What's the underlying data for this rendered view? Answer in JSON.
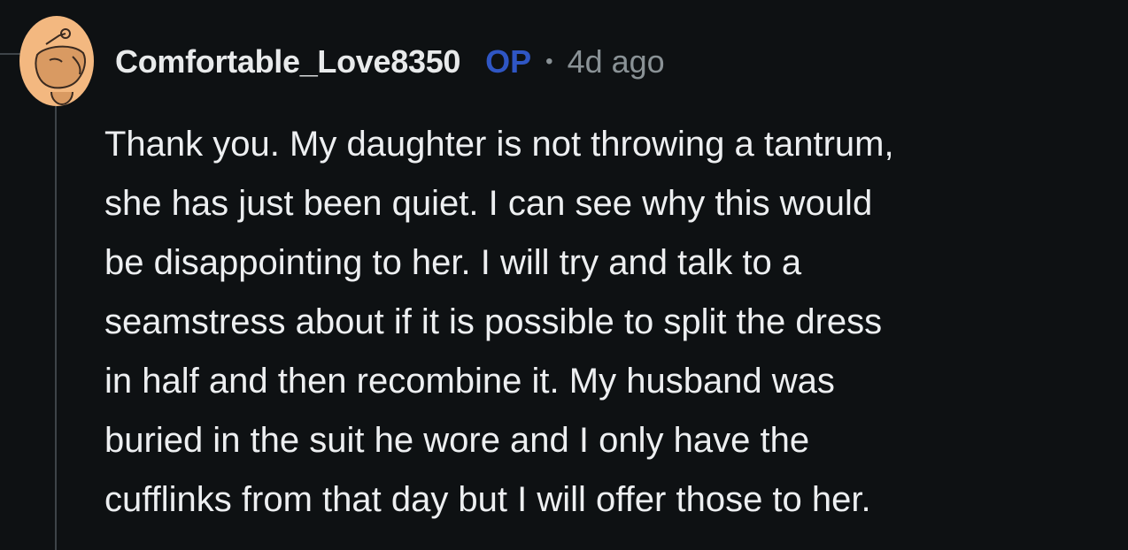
{
  "comment": {
    "author": "Comfortable_Love8350",
    "op_badge": "OP",
    "separator": "•",
    "timestamp": "4d ago",
    "avatar": "snoo-avatar-icon",
    "body_lines": [
      "Thank you. My daughter is not throwing a tantrum,",
      "she has just been quiet. I can see why this would",
      "be disappointing to her. I will try and talk to a",
      "seamstress about if it is possible to split the dress",
      "in half and then recombine it. My husband was",
      "buried in the suit he wore and I only have the",
      "cufflinks from that day but I will offer those to her."
    ]
  },
  "colors": {
    "background": "#0e1113",
    "text": "#edeff1",
    "op_badge": "#2f56c4",
    "meta": "#8a9296",
    "thread_line": "#3e4449",
    "avatar_bg": "#f3b880"
  }
}
